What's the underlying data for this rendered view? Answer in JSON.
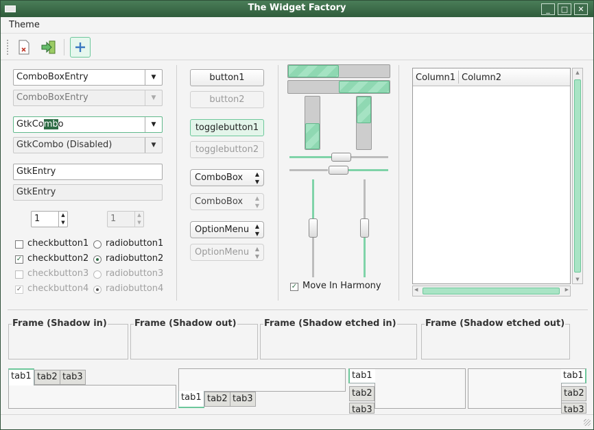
{
  "window": {
    "title": "The Widget Factory",
    "minimize": "_",
    "maximize": "□",
    "close": "✕"
  },
  "menu": {
    "theme": "Theme"
  },
  "toolbar": {
    "new_icon": "new-file-icon",
    "quit_icon": "exit-icon",
    "add_icon": "plus-icon"
  },
  "col1": {
    "combo_entry_1": "ComboBoxEntry",
    "combo_entry_2": "ComboBoxEntry",
    "gtk_combo_pre": "GtkCo",
    "gtk_combo_sel": "mb",
    "gtk_combo_post": "o",
    "gtk_combo_dis": "GtkCombo (Disabled)",
    "entry_1": "GtkEntry",
    "entry_2": "GtkEntry",
    "spin_1": "1",
    "spin_2": "1",
    "checks": [
      "checkbutton1",
      "checkbutton2",
      "checkbutton3",
      "checkbutton4"
    ],
    "radios": [
      "radiobutton1",
      "radiobutton2",
      "radiobutton3",
      "radiobutton4"
    ]
  },
  "col2": {
    "button1": "button1",
    "button2": "button2",
    "toggle1": "togglebutton1",
    "toggle2": "togglebutton2",
    "combobox1": "ComboBox",
    "combobox2": "ComboBox",
    "option1": "OptionMenu",
    "option2": "OptionMenu"
  },
  "col3": {
    "progress_h1": 0.5,
    "progress_h2": 0.5,
    "progress_v1": 0.5,
    "progress_v2": 0.5,
    "harmony": "Move In Harmony"
  },
  "tree": {
    "columns": [
      "Column1",
      "Column2"
    ]
  },
  "frames": [
    "Frame (Shadow in)",
    "Frame (Shadow out)",
    "Frame (Shadow etched in)",
    "Frame (Shadow etched out)"
  ],
  "tabs": [
    "tab1",
    "tab2",
    "tab3"
  ],
  "colors": {
    "accent": "#6cc79a",
    "title": "#2f5c3b"
  }
}
